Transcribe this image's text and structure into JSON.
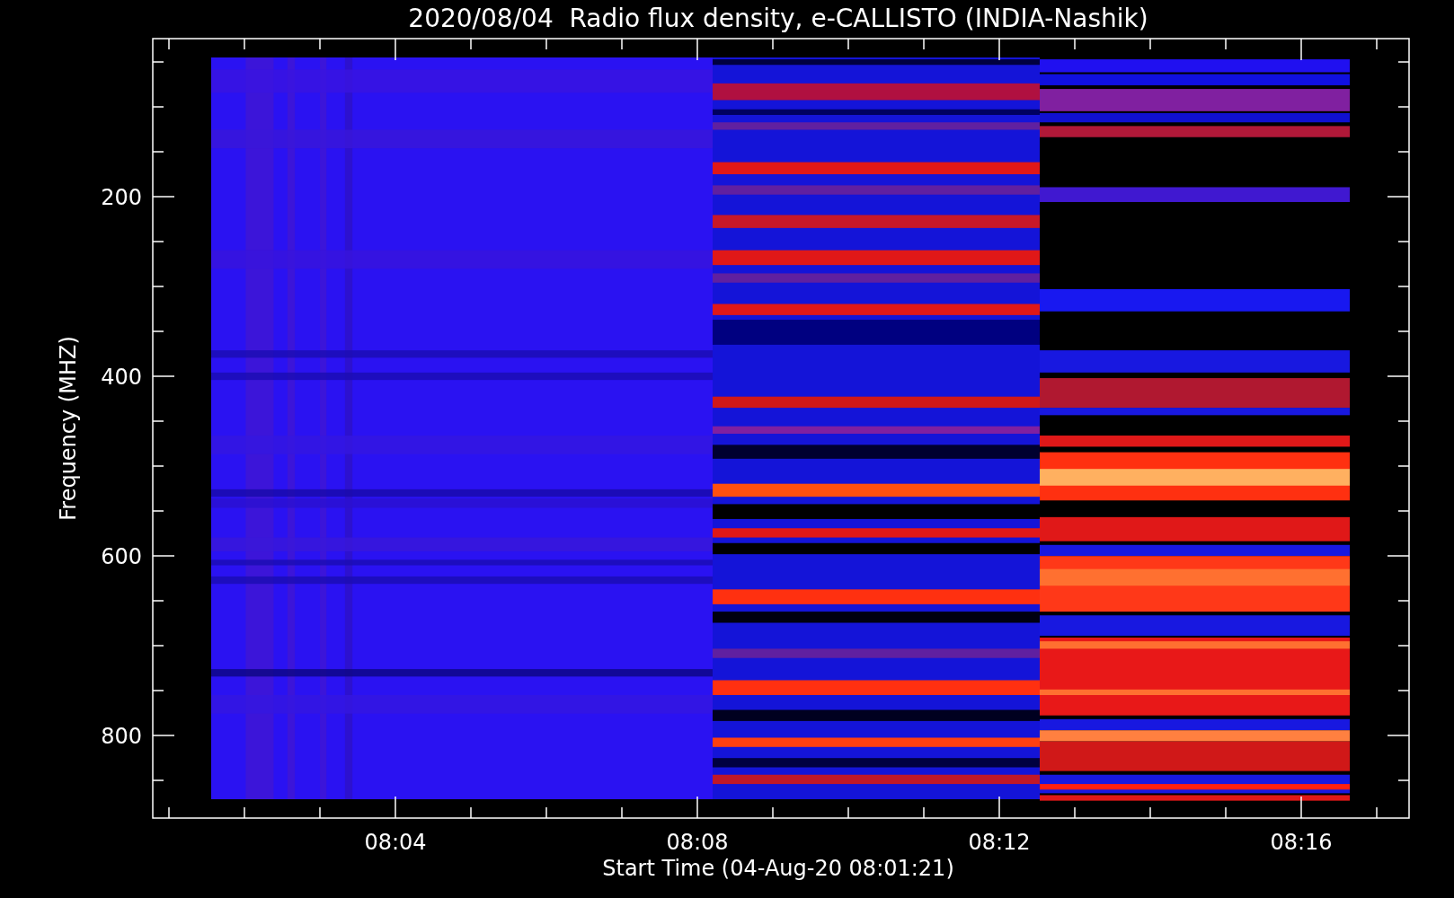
{
  "title": "2020/08/04  Radio flux density, e-CALLISTO (INDIA-Nashik)",
  "y_axis": {
    "label": "Frequency (MHZ)",
    "ticks": [
      "200",
      "400",
      "600",
      "800"
    ]
  },
  "x_axis": {
    "label": "Start Time (04-Aug-20 08:01:21)",
    "ticks": [
      "08:04",
      "08:08",
      "08:12",
      "08:16"
    ]
  }
}
